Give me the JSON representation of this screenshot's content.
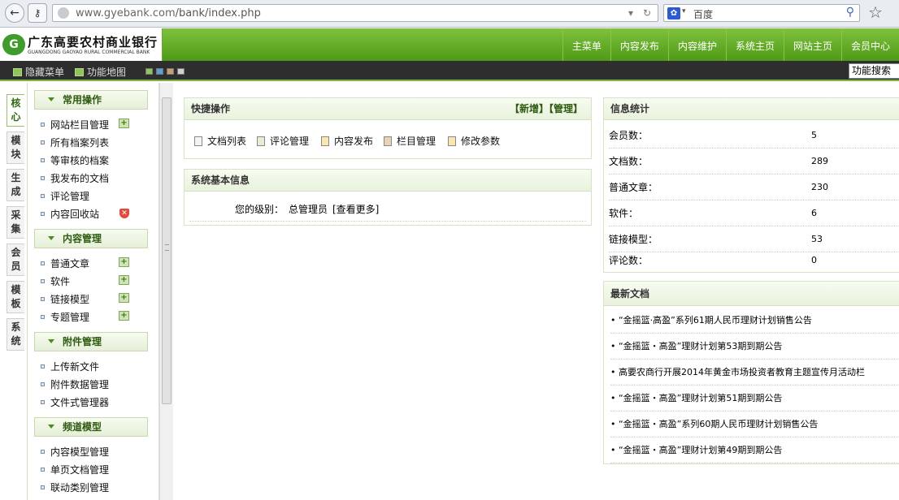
{
  "browser": {
    "url_host": "www.gyebank.com",
    "url_path": "/bank/index.php",
    "search_engine": "百度"
  },
  "header": {
    "logo_cn": "广东高要农村商业银行",
    "logo_en": "GUANGDONG GAOYAO RURAL COMMERCIAL BANK",
    "nav": [
      "主菜单",
      "内容发布",
      "内容维护",
      "系统主页",
      "网站主页",
      "会员中心"
    ]
  },
  "subbar": {
    "hide_menu": "隐藏菜单",
    "func_map": "功能地图",
    "func_search": "功能搜索"
  },
  "left_tabs": [
    "核心",
    "模块",
    "生成",
    "采集",
    "会员",
    "模板",
    "系统"
  ],
  "menu": {
    "sections": [
      {
        "title": "常用操作",
        "items": [
          "网站栏目管理",
          "所有档案列表",
          "等审核的档案",
          "我发布的文档",
          "评论管理",
          "内容回收站"
        ]
      },
      {
        "title": "内容管理",
        "items": [
          "普通文章",
          "软件",
          "链接模型",
          "专题管理"
        ]
      },
      {
        "title": "附件管理",
        "items": [
          "上传新文件",
          "附件数据管理",
          "文件式管理器"
        ]
      },
      {
        "title": "频道模型",
        "items": [
          "内容模型管理",
          "单页文档管理",
          "联动类别管理"
        ]
      }
    ]
  },
  "quick": {
    "title": "快捷操作",
    "add": "【新增】",
    "manage": "【管理】",
    "items": [
      "文档列表",
      "评论管理",
      "内容发布",
      "栏目管理",
      "修改参数"
    ]
  },
  "sysinfo": {
    "title": "系统基本信息",
    "level_label": "您的级别：",
    "level_value": "总管理员",
    "more": "[查看更多]"
  },
  "stats": {
    "title": "信息统计",
    "rows": [
      {
        "label": "会员数：",
        "value": "5"
      },
      {
        "label": "文档数：",
        "value": "289"
      },
      {
        "label": "普通文章：",
        "value": "230"
      },
      {
        "label": "软件：",
        "value": "6"
      },
      {
        "label": "链接模型：",
        "value": "53"
      },
      {
        "label": "评论数：",
        "value": "0"
      }
    ]
  },
  "latest": {
    "title": "最新文档",
    "items": [
      "• “金摇篮·高盈”系列61期人民币理财计划销售公告",
      "• “金摇篮・高盈”理财计划第53期到期公告",
      "• 高要农商行开展2014年黄金市场投资者教育主题宣传月活动栏",
      "• “金摇篮・高盈”理财计划第51期到期公告",
      "• “金摇篮・高盈”系列60期人民币理财计划销售公告",
      "• “金摇篮・高盈”理财计划第49期到期公告"
    ]
  }
}
